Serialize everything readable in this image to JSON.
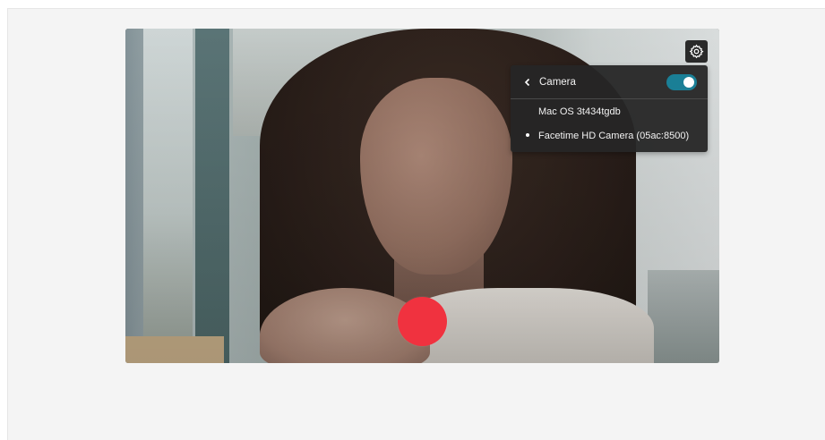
{
  "camera_menu": {
    "title": "Camera",
    "enabled": true,
    "devices": [
      {
        "label": "Mac OS 3t434tgdb",
        "selected": false
      },
      {
        "label": "Facetime HD Camera (05ac:8500)",
        "selected": true
      }
    ]
  },
  "icons": {
    "settings": "gear-icon",
    "back": "chevron-left-icon",
    "record": "record-icon"
  },
  "colors": {
    "toggle_on": "#1a7f96",
    "record": "#f0323f",
    "menu_bg": "#262626"
  }
}
